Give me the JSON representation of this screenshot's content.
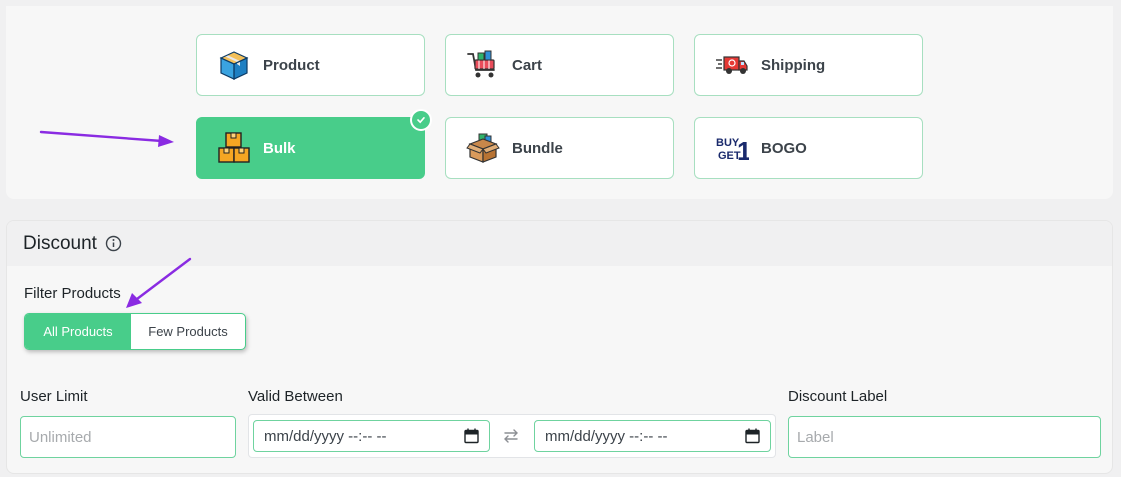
{
  "types": [
    {
      "id": "product",
      "label": "Product",
      "icon": "product-box-icon",
      "active": false
    },
    {
      "id": "cart",
      "label": "Cart",
      "icon": "cart-icon",
      "active": false
    },
    {
      "id": "shipping",
      "label": "Shipping",
      "icon": "shipping-truck-icon",
      "active": false
    },
    {
      "id": "bulk",
      "label": "Bulk",
      "icon": "bulk-boxes-icon",
      "active": true
    },
    {
      "id": "bundle",
      "label": "Bundle",
      "icon": "bundle-box-icon",
      "active": false
    },
    {
      "id": "bogo",
      "label": "BOGO",
      "icon": "buy-get-icon",
      "active": false
    }
  ],
  "bogo_icon_text": {
    "line1": "BUY",
    "line2": "GET",
    "digit": "1"
  },
  "discount": {
    "title": "Discount",
    "filter_label": "Filter Products",
    "filter_options": {
      "all": "All Products",
      "few": "Few Products",
      "selected": "All Products"
    }
  },
  "fields": {
    "user_limit": {
      "label": "User Limit",
      "placeholder": "Unlimited"
    },
    "valid_between": {
      "label": "Valid Between",
      "start_placeholder": "mm/dd/yyyy --:-- --",
      "end_placeholder": "mm/dd/yyyy --:-- --"
    },
    "discount_label": {
      "label": "Discount Label",
      "placeholder": "Label"
    }
  },
  "colors": {
    "accent": "#48cd8a",
    "annotation_arrow": "#8a2be2"
  }
}
